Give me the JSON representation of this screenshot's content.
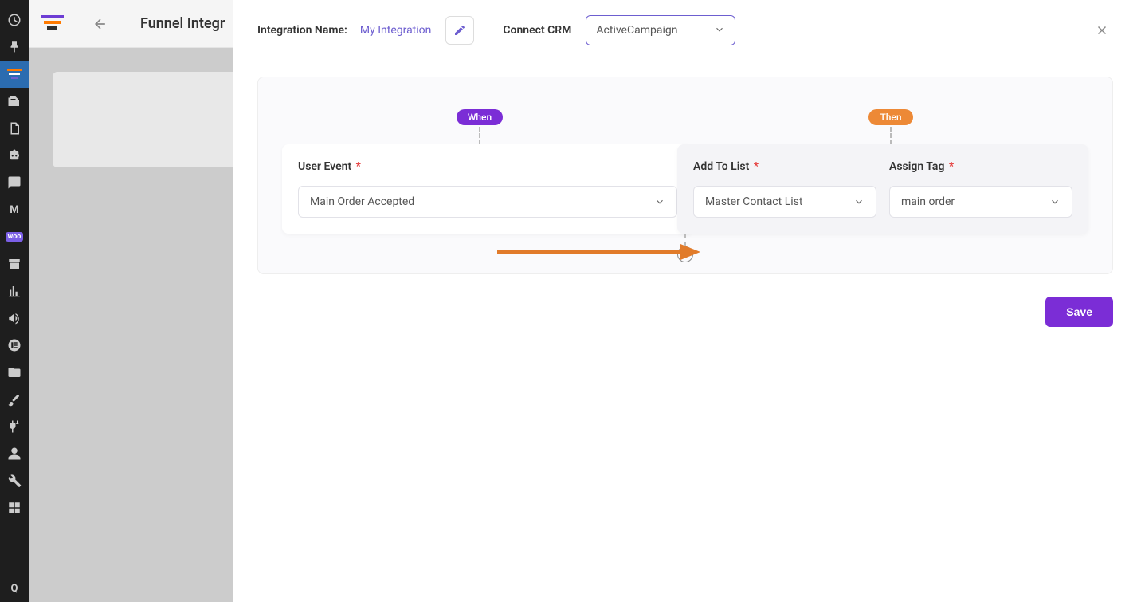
{
  "bg": {
    "page_title": "Funnel Integr"
  },
  "modal": {
    "integration_name_label": "Integration Name:",
    "integration_name_value": "My Integration",
    "connect_crm_label": "Connect CRM",
    "crm_value": "ActiveCampaign",
    "when_label": "When",
    "then_label": "Then",
    "user_event_label": "User Event",
    "user_event_value": "Main Order Accepted",
    "add_to_list_label": "Add To List",
    "add_to_list_value": "Master Contact List",
    "assign_tag_label": "Assign Tag",
    "assign_tag_value": "main order",
    "required": "*",
    "save_label": "Save"
  },
  "colors": {
    "purple": "#7b2dd6",
    "orange": "#ed8936",
    "arrow": "#e17b2a"
  }
}
